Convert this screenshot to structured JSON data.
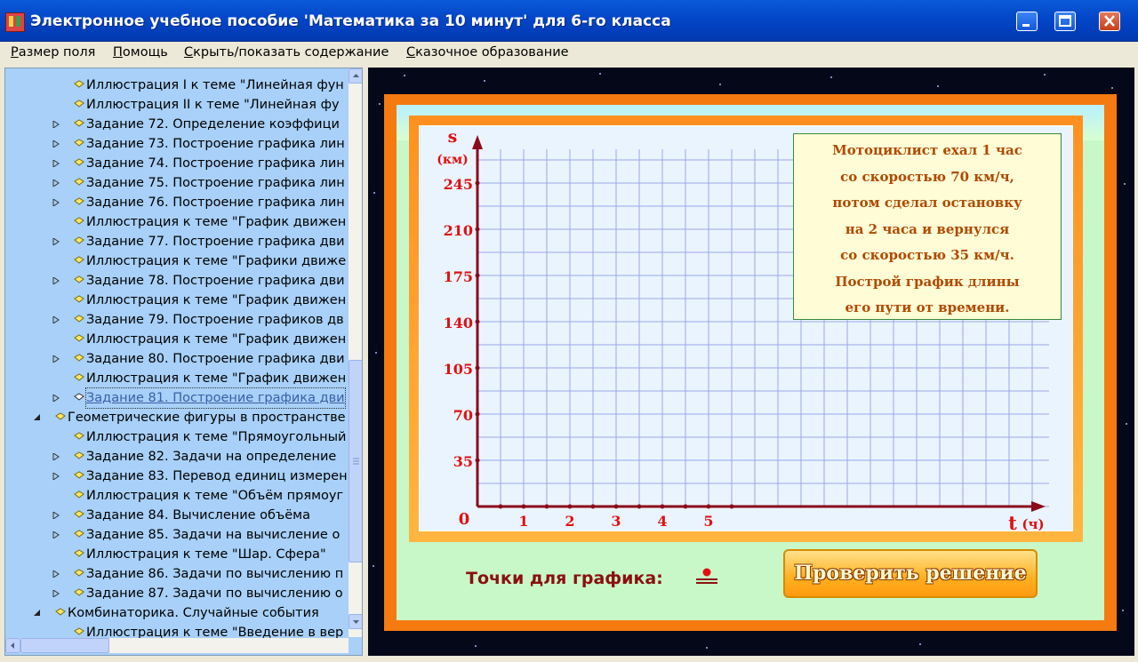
{
  "window": {
    "title": "Электронное учебное пособие 'Математика за 10 минут' для 6-го класса",
    "buttons": [
      "minimize",
      "maximize",
      "close"
    ]
  },
  "menu": [
    {
      "label": "Размер поля",
      "hotkey": "Р"
    },
    {
      "label": "Помощь",
      "hotkey": "П"
    },
    {
      "label": "Скрыть/показать содержание",
      "hotkey": "С"
    },
    {
      "label": "Сказочное образование",
      "hotkey": "С"
    }
  ],
  "tree": [
    {
      "label": "Иллюстрация I к теме \"Линейная фун",
      "level": 2,
      "expandable": false,
      "selected": false
    },
    {
      "label": "Иллюстрация II к теме \"Линейная фу",
      "level": 2,
      "expandable": false,
      "selected": false
    },
    {
      "label": "Задание 72. Определение коэффици",
      "level": 2,
      "expandable": true,
      "selected": false
    },
    {
      "label": "Задание 73. Построение графика лин",
      "level": 2,
      "expandable": true,
      "selected": false
    },
    {
      "label": "Задание 74. Построение графика лин",
      "level": 2,
      "expandable": true,
      "selected": false
    },
    {
      "label": "Задание 75. Построение графика лин",
      "level": 2,
      "expandable": true,
      "selected": false
    },
    {
      "label": "Задание 76. Построение графика лин",
      "level": 2,
      "expandable": true,
      "selected": false
    },
    {
      "label": "Иллюстрация к теме \"График движен",
      "level": 2,
      "expandable": false,
      "selected": false
    },
    {
      "label": "Задание 77. Построение графика дви",
      "level": 2,
      "expandable": true,
      "selected": false
    },
    {
      "label": "Иллюстрация к теме \"Графики движе",
      "level": 2,
      "expandable": false,
      "selected": false
    },
    {
      "label": "Задание 78. Построение графика дви",
      "level": 2,
      "expandable": true,
      "selected": false
    },
    {
      "label": "Иллюстрация к теме \"График движен",
      "level": 2,
      "expandable": false,
      "selected": false
    },
    {
      "label": "Задание 79. Построение графиков дв",
      "level": 2,
      "expandable": true,
      "selected": false
    },
    {
      "label": "Иллюстрация к теме \"График движен",
      "level": 2,
      "expandable": false,
      "selected": false
    },
    {
      "label": "Задание 80. Построение графика дви",
      "level": 2,
      "expandable": true,
      "selected": false
    },
    {
      "label": "Иллюстрация к теме \"График движен",
      "level": 2,
      "expandable": false,
      "selected": false
    },
    {
      "label": "Задание 81. Построение графика дви",
      "level": 2,
      "expandable": true,
      "selected": true
    },
    {
      "label": "Геометрические фигуры в пространстве",
      "level": 1,
      "expandable": true,
      "selected": false,
      "expanded": true
    },
    {
      "label": "Иллюстрация к теме \"Прямоугольный",
      "level": 2,
      "expandable": false,
      "selected": false
    },
    {
      "label": "Задание 82. Задачи на определение",
      "level": 2,
      "expandable": true,
      "selected": false
    },
    {
      "label": "Задание 83. Перевод единиц измерен",
      "level": 2,
      "expandable": true,
      "selected": false
    },
    {
      "label": "Иллюстрация к теме \"Объём прямоуг",
      "level": 2,
      "expandable": false,
      "selected": false
    },
    {
      "label": "Задание 84. Вычисление объёма",
      "level": 2,
      "expandable": true,
      "selected": false
    },
    {
      "label": "Задание 85. Задачи на вычисление о",
      "level": 2,
      "expandable": true,
      "selected": false
    },
    {
      "label": "Иллюстрация к теме \"Шар. Сфера\"",
      "level": 2,
      "expandable": false,
      "selected": false
    },
    {
      "label": "Задание 86. Задачи по вычислению п",
      "level": 2,
      "expandable": true,
      "selected": false
    },
    {
      "label": "Задание 87. Задачи по вычислению о",
      "level": 2,
      "expandable": true,
      "selected": false
    },
    {
      "label": "Комбинаторика. Случайные события",
      "level": 1,
      "expandable": true,
      "selected": false,
      "expanded": true
    },
    {
      "label": "Иллюстрация к теме \"Введение в вер",
      "level": 2,
      "expandable": false,
      "selected": false
    }
  ],
  "chart_data": {
    "type": "line",
    "ylabel": "s",
    "ylabel_unit": "(км)",
    "xlabel": "t",
    "xlabel_unit": "(ч)",
    "origin_label": "0",
    "x_ticks": [
      1,
      2,
      3,
      4,
      5
    ],
    "y_ticks": [
      35,
      70,
      105,
      140,
      175,
      210,
      245
    ],
    "xlim": [
      0,
      6
    ],
    "ylim": [
      0,
      262.5
    ],
    "grid": true,
    "series": []
  },
  "task": {
    "lines": [
      "Мотоциклист ехал 1 час",
      "со скоростью 70 км/ч,",
      "потом сделал остановку",
      "на 2 часа и вернулся",
      "со скоростью 35 км/ч.",
      "Построй график длины",
      "его пути от времени."
    ]
  },
  "points_label": "Точки для графика:",
  "check_button": "Проверить решение",
  "colors": {
    "axis": "#8b0a1a",
    "grid": "#9aa6e8",
    "tick_label": "#e01010",
    "frame": "#f57a10",
    "task_text": "#b04a00"
  }
}
